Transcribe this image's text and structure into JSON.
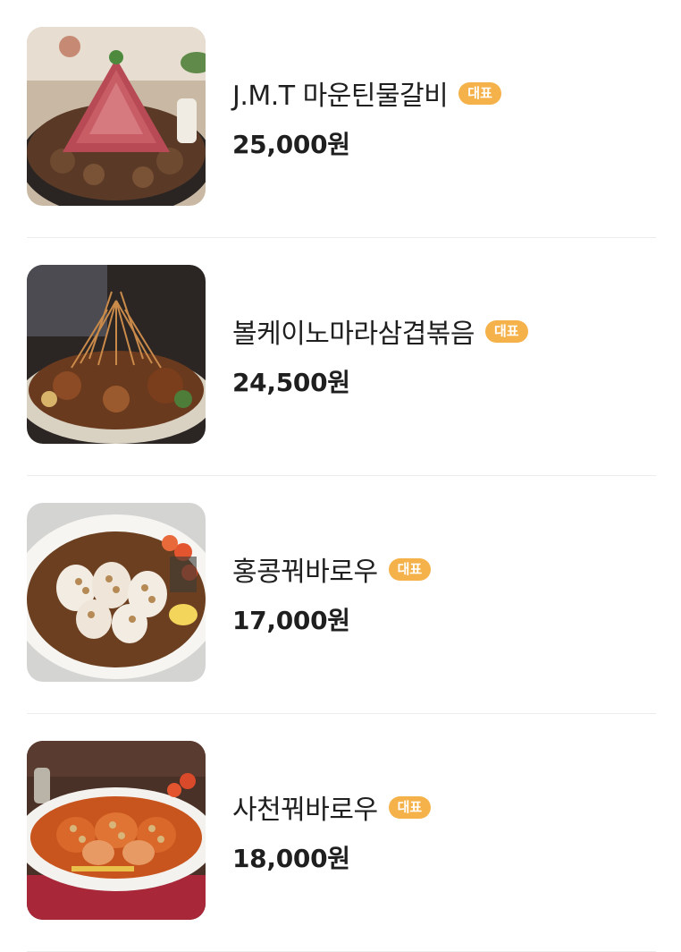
{
  "menu": {
    "items": [
      {
        "name": "J.M.T 마운틴물갈비",
        "badge": "대표",
        "price": "25,000원",
        "image_icon": "beef-galbi-photo"
      },
      {
        "name": "볼케이노마라삼겹볶음",
        "badge": "대표",
        "price": "24,500원",
        "image_icon": "mala-pork-photo"
      },
      {
        "name": "홍콩꿔바로우",
        "badge": "대표",
        "price": "17,000원",
        "image_icon": "hongkong-guobaorou-photo"
      },
      {
        "name": "사천꿔바로우",
        "badge": "대표",
        "price": "18,000원",
        "image_icon": "sichuan-guobaorou-photo"
      }
    ]
  },
  "colors": {
    "badge_bg": "#f5b24a",
    "text": "#1f1f1f",
    "divider": "#ececec"
  }
}
